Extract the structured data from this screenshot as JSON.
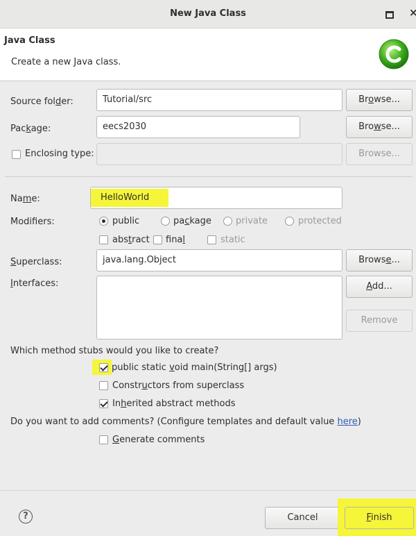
{
  "window": {
    "title": "New Java Class"
  },
  "header": {
    "title": "Java Class",
    "subtitle": "Create a new Java class."
  },
  "source_folder": {
    "label_pre": "Source fol",
    "label_ul": "d",
    "label_post": "er:",
    "value": "Tutorial/src",
    "button_pre": "Br",
    "button_ul": "o",
    "button_post": "wse..."
  },
  "package": {
    "label_pre": "Pac",
    "label_ul": "k",
    "label_post": "age:",
    "value": "eecs2030",
    "button_pre": "Bro",
    "button_ul": "w",
    "button_post": "se..."
  },
  "enclosing": {
    "label": "Enclosing type:",
    "value": "",
    "button": "Browse..."
  },
  "name": {
    "label_pre": "Na",
    "label_ul": "m",
    "label_post": "e:",
    "value": "HelloWorld"
  },
  "modifiers": {
    "label": "Modifiers:",
    "public": "public",
    "package_pre": "pa",
    "package_ul": "c",
    "package_post": "kage",
    "private": "private",
    "protected": "protected",
    "abstract_pre": "abs",
    "abstract_ul": "t",
    "abstract_post": "ract",
    "final_pre": "fina",
    "final_ul": "l",
    "final_post": "",
    "static": "static"
  },
  "superclass": {
    "label_ul": "S",
    "label_post": "uperclass:",
    "value": "java.lang.Object",
    "button_pre": "Brows",
    "button_ul": "e",
    "button_post": "..."
  },
  "interfaces": {
    "label_ul": "I",
    "label_post": "nterfaces:",
    "add_ul": "A",
    "add_post": "dd...",
    "remove": "Remove"
  },
  "stubs": {
    "question": "Which method stubs would you like to create?",
    "main_pre": "public static ",
    "main_ul": "v",
    "main_post": "oid main(String[] args)",
    "constructors_pre": "Constr",
    "constructors_ul": "u",
    "constructors_post": "ctors from superclass",
    "inherited_pre": "In",
    "inherited_ul": "h",
    "inherited_post": "erited abstract methods"
  },
  "comments": {
    "question_pre": "Do you want to add comments? (Configure templates and default value ",
    "link": "here",
    "question_post": ")",
    "generate_ul": "G",
    "generate_post": "enerate comments"
  },
  "footer": {
    "help_glyph": "?",
    "cancel": "Cancel",
    "finish_ul": "F",
    "finish_post": "inish"
  },
  "colors": {
    "highlight": "#f5f53a",
    "link": "#2a5db0"
  }
}
